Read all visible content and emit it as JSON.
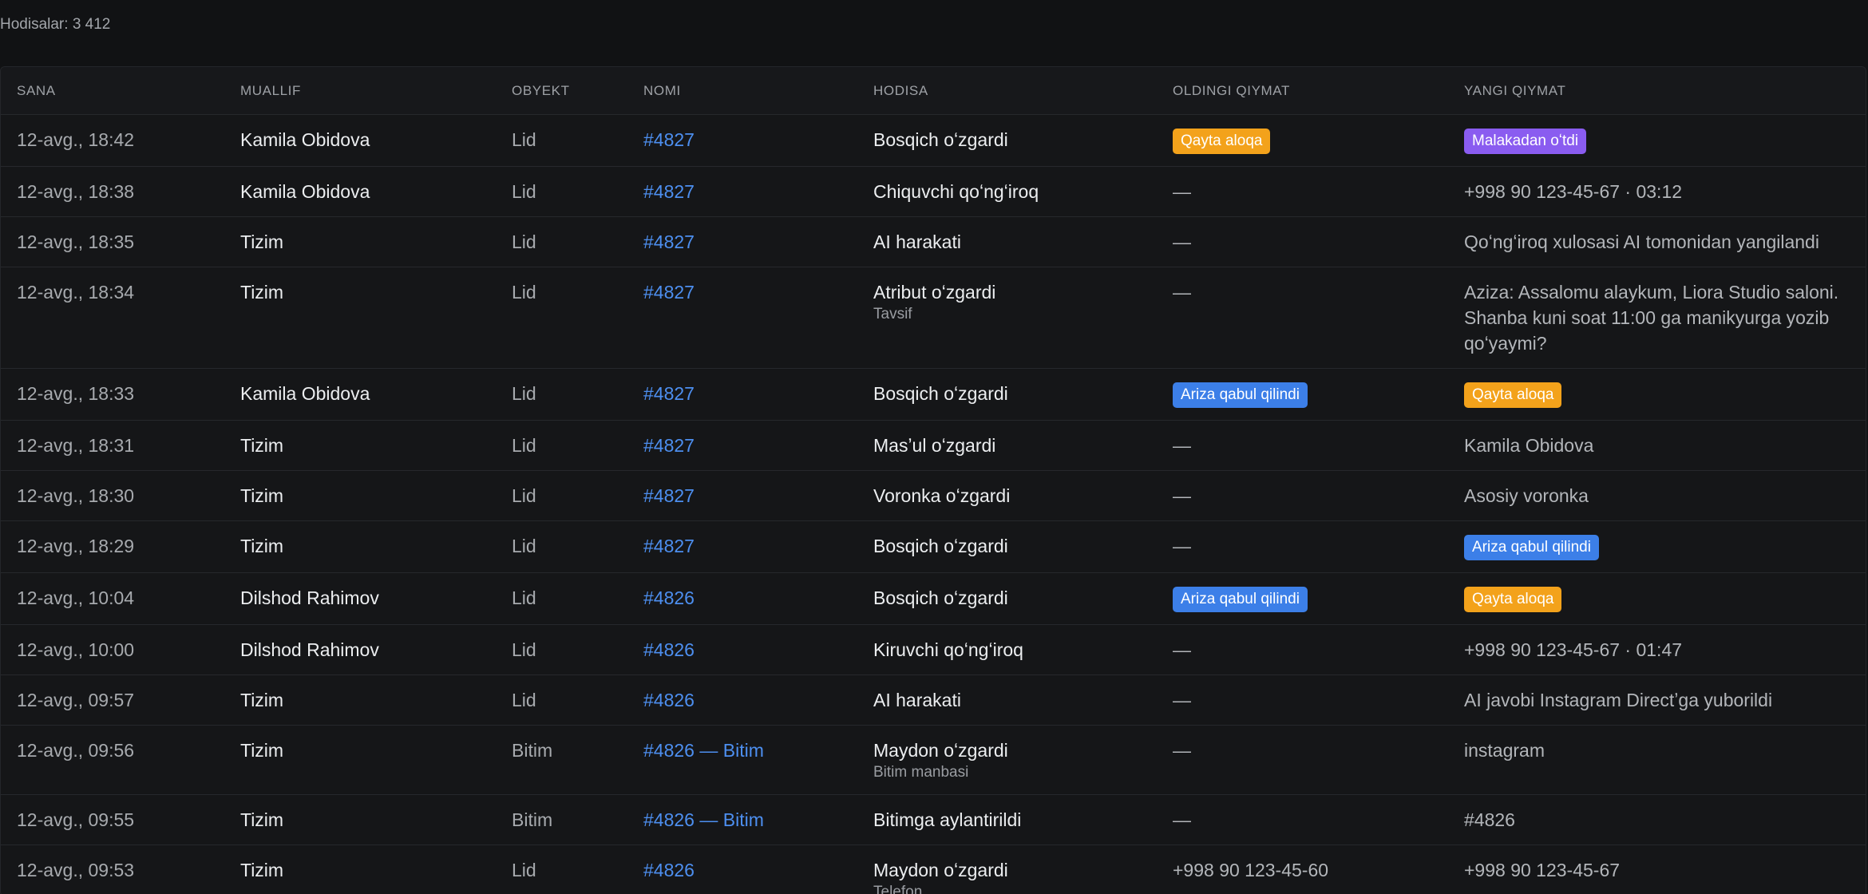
{
  "summary": {
    "label": "Hodisalar: 3 412"
  },
  "colors": {
    "background": "#111214",
    "link": "#4d8ff0",
    "badge_orange": "#f3a21b",
    "badge_purple": "#8a5cf0",
    "badge_blue": "#3c7fe8"
  },
  "table": {
    "headers": [
      "SANA",
      "MUALLIF",
      "OBYEKT",
      "NOMI",
      "HODISA",
      "OLDINGI QIYMAT",
      "YANGI QIYMAT"
    ],
    "rows": [
      {
        "date": "12-avg., 18:42",
        "author": "Kamila Obidova",
        "object": "Lid",
        "name": "#4827",
        "event": "Bosqich oʻzgardi",
        "event_sub": "",
        "old_value": {
          "type": "badge",
          "text": "Qayta aloqa",
          "color": "orange"
        },
        "new_value": {
          "type": "badge",
          "text": "Malakadan oʻtdi",
          "color": "purple"
        }
      },
      {
        "date": "12-avg., 18:38",
        "author": "Kamila Obidova",
        "object": "Lid",
        "name": "#4827",
        "event": "Chiquvchi qoʻngʻiroq",
        "event_sub": "",
        "old_value": {
          "type": "text",
          "text": "—"
        },
        "new_value": {
          "type": "text",
          "text": "+998 90 123-45-67 · 03:12"
        }
      },
      {
        "date": "12-avg., 18:35",
        "author": "Tizim",
        "object": "Lid",
        "name": "#4827",
        "event": "AI harakati",
        "event_sub": "",
        "old_value": {
          "type": "text",
          "text": "—"
        },
        "new_value": {
          "type": "text",
          "text": "Qoʻngʻiroq xulosasi AI tomonidan yangilandi"
        }
      },
      {
        "date": "12-avg., 18:34",
        "author": "Tizim",
        "object": "Lid",
        "name": "#4827",
        "event": "Atribut oʻzgardi",
        "event_sub": "Tavsif",
        "old_value": {
          "type": "text",
          "text": "—"
        },
        "new_value": {
          "type": "text",
          "text": "Aziza: Assalomu alaykum, Liora Studio saloni. Shanba kuni soat 11:00 ga manikyurga yozib qoʻyaymi?"
        }
      },
      {
        "date": "12-avg., 18:33",
        "author": "Kamila Obidova",
        "object": "Lid",
        "name": "#4827",
        "event": "Bosqich oʻzgardi",
        "event_sub": "",
        "old_value": {
          "type": "badge",
          "text": "Ariza qabul qilindi",
          "color": "blue"
        },
        "new_value": {
          "type": "badge",
          "text": "Qayta aloqa",
          "color": "orange"
        }
      },
      {
        "date": "12-avg., 18:31",
        "author": "Tizim",
        "object": "Lid",
        "name": "#4827",
        "event": "Masʼul oʻzgardi",
        "event_sub": "",
        "old_value": {
          "type": "text",
          "text": "—"
        },
        "new_value": {
          "type": "text",
          "text": "Kamila Obidova"
        }
      },
      {
        "date": "12-avg., 18:30",
        "author": "Tizim",
        "object": "Lid",
        "name": "#4827",
        "event": "Voronka oʻzgardi",
        "event_sub": "",
        "old_value": {
          "type": "text",
          "text": "—"
        },
        "new_value": {
          "type": "text",
          "text": "Asosiy voronka"
        }
      },
      {
        "date": "12-avg., 18:29",
        "author": "Tizim",
        "object": "Lid",
        "name": "#4827",
        "event": "Bosqich oʻzgardi",
        "event_sub": "",
        "old_value": {
          "type": "text",
          "text": "—"
        },
        "new_value": {
          "type": "badge",
          "text": "Ariza qabul qilindi",
          "color": "blue"
        }
      },
      {
        "date": "12-avg., 10:04",
        "author": "Dilshod Rahimov",
        "object": "Lid",
        "name": "#4826",
        "event": "Bosqich oʻzgardi",
        "event_sub": "",
        "old_value": {
          "type": "badge",
          "text": "Ariza qabul qilindi",
          "color": "blue"
        },
        "new_value": {
          "type": "badge",
          "text": "Qayta aloqa",
          "color": "orange"
        }
      },
      {
        "date": "12-avg., 10:00",
        "author": "Dilshod Rahimov",
        "object": "Lid",
        "name": "#4826",
        "event": "Kiruvchi qoʻngʻiroq",
        "event_sub": "",
        "old_value": {
          "type": "text",
          "text": "—"
        },
        "new_value": {
          "type": "text",
          "text": "+998 90 123-45-67 · 01:47"
        }
      },
      {
        "date": "12-avg., 09:57",
        "author": "Tizim",
        "object": "Lid",
        "name": "#4826",
        "event": "AI harakati",
        "event_sub": "",
        "old_value": {
          "type": "text",
          "text": "—"
        },
        "new_value": {
          "type": "text",
          "text": "AI javobi Instagram Directʼga yuborildi"
        }
      },
      {
        "date": "12-avg., 09:56",
        "author": "Tizim",
        "object": "Bitim",
        "name": "#4826 — Bitim",
        "event": "Maydon oʻzgardi",
        "event_sub": "Bitim manbasi",
        "old_value": {
          "type": "text",
          "text": "—"
        },
        "new_value": {
          "type": "text",
          "text": "instagram"
        }
      },
      {
        "date": "12-avg., 09:55",
        "author": "Tizim",
        "object": "Bitim",
        "name": "#4826 — Bitim",
        "event": "Bitimga aylantirildi",
        "event_sub": "",
        "old_value": {
          "type": "text",
          "text": "—"
        },
        "new_value": {
          "type": "text",
          "text": "#4826"
        }
      },
      {
        "date": "12-avg., 09:53",
        "author": "Tizim",
        "object": "Lid",
        "name": "#4826",
        "event": "Maydon oʻzgardi",
        "event_sub": "Telefon",
        "old_value": {
          "type": "text",
          "text": "+998 90 123-45-60"
        },
        "new_value": {
          "type": "text",
          "text": "+998 90 123-45-67"
        }
      }
    ]
  }
}
